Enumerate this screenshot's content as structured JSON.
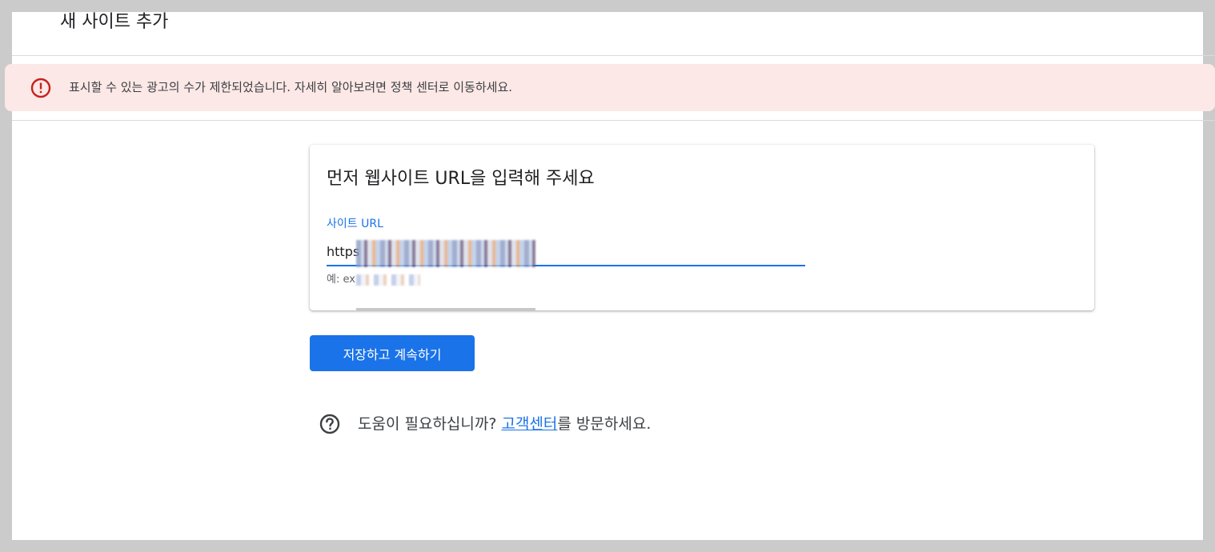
{
  "header": {
    "title": "새 사이트 추가"
  },
  "alert": {
    "icon": "alert-circle-icon",
    "color": "#c5221f",
    "background": "#fce8e6",
    "message": "표시할 수 있는 광고의 수가 제한되었습니다. 자세히 알아보려면 정책 센터로 이동하세요."
  },
  "card": {
    "title": "먼저 웹사이트 URL을 입력해 주세요",
    "field_label": "사이트 URL",
    "input_value": "https",
    "helper_text": "예: ex"
  },
  "actions": {
    "save_label": "저장하고 계속하기",
    "accent": "#1a73e8"
  },
  "help": {
    "icon": "help-circle-icon",
    "prefix": "도움이 필요하십니까? ",
    "link_text": "고객센터",
    "suffix": "를 방문하세요."
  }
}
